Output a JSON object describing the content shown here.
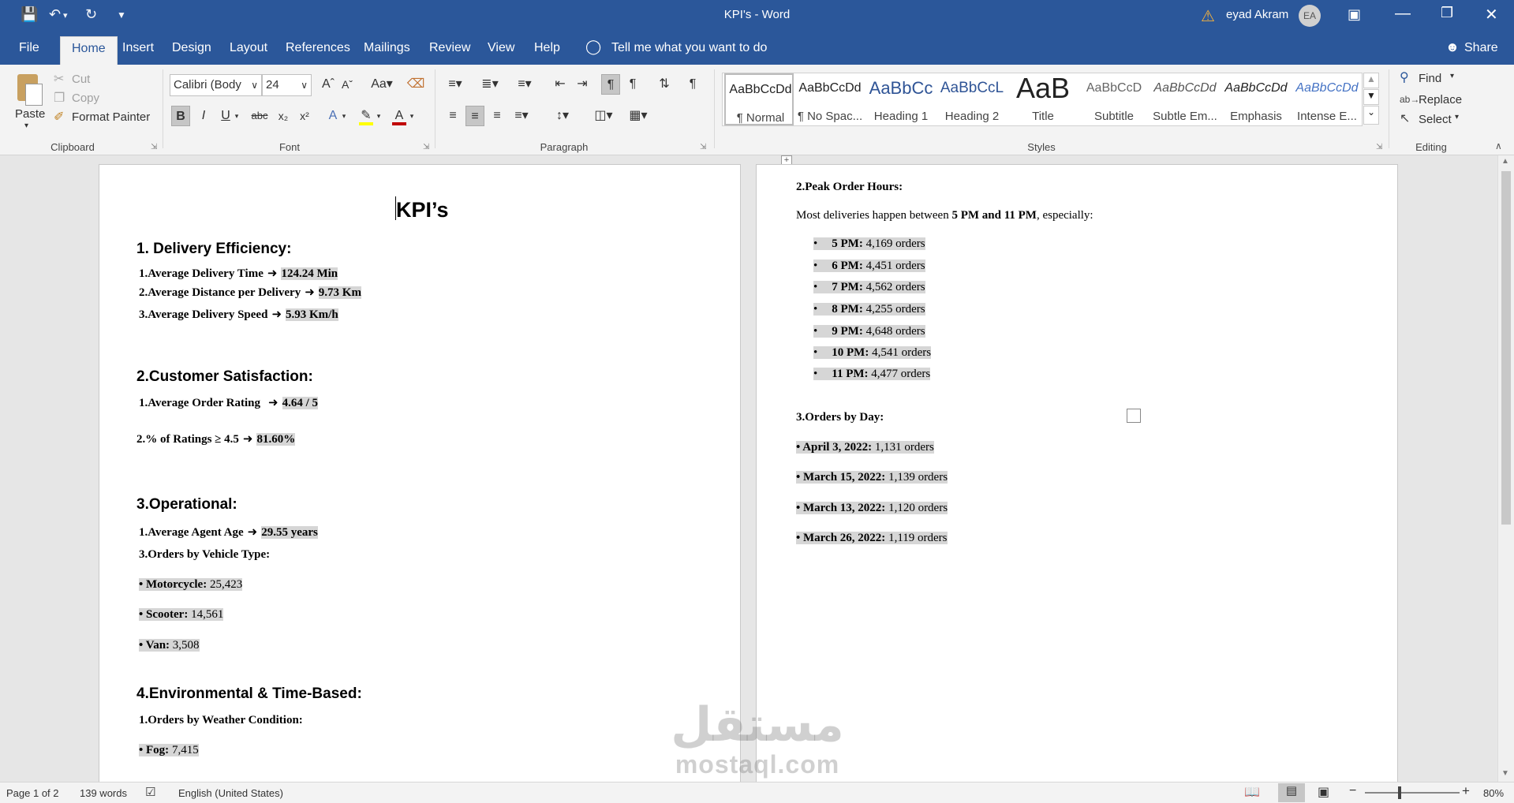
{
  "window": {
    "title": "KPI's  -  Word",
    "user_name": "eyad Akram",
    "user_initials": "EA"
  },
  "menu_tabs": [
    {
      "label": "File"
    },
    {
      "label": "Home"
    },
    {
      "label": "Insert"
    },
    {
      "label": "Design"
    },
    {
      "label": "Layout"
    },
    {
      "label": "References"
    },
    {
      "label": "Mailings"
    },
    {
      "label": "Review"
    },
    {
      "label": "View"
    },
    {
      "label": "Help"
    }
  ],
  "tell_me": "Tell me what you want to do",
  "share_label": "Share",
  "clipboard": {
    "paste": "Paste",
    "cut": "Cut",
    "copy": "Copy",
    "format_painter": "Format Painter",
    "label": "Clipboard"
  },
  "font": {
    "name": "Calibri (Body",
    "size": "24",
    "label": "Font",
    "highlight_color": "#ffff00",
    "font_color": "#c00000"
  },
  "paragraph": {
    "label": "Paragraph"
  },
  "styles": {
    "label": "Styles",
    "items": [
      {
        "preview": "AaBbCcDd",
        "name": "¶ Normal"
      },
      {
        "preview": "AaBbCcDd",
        "name": "¶ No Spac..."
      },
      {
        "preview": "AaBbCc",
        "name": "Heading 1"
      },
      {
        "preview": "AaBbCcL",
        "name": "Heading 2"
      },
      {
        "preview": "AaB",
        "name": "Title"
      },
      {
        "preview": "AaBbCcD",
        "name": "Subtitle"
      },
      {
        "preview": "AaBbCcDd",
        "name": "Subtle Em..."
      },
      {
        "preview": "AaBbCcDd",
        "name": "Emphasis"
      },
      {
        "preview": "AaBbCcDd",
        "name": "Intense E..."
      }
    ]
  },
  "editing": {
    "find": "Find",
    "replace": "Replace",
    "select": "Select",
    "label": "Editing"
  },
  "document": {
    "page1": {
      "title": "KPI’s",
      "s1_heading": "1. Delivery Efficiency:",
      "s1": [
        {
          "num": "1.",
          "label": "Average Delivery Time",
          "value": "124.24 Min"
        },
        {
          "num": "2.",
          "label": "Average Distance per Delivery",
          "value": "9.73 Km"
        },
        {
          "num": "3.",
          "label": "Average Delivery Speed",
          "value": "5.93 Km/h"
        }
      ],
      "s2_heading": "2.Customer Satisfaction:",
      "s2": [
        {
          "num": "1.",
          "label": "Average Order Rating",
          "value": "4.64 / 5"
        },
        {
          "num": "2.",
          "label": "% of Ratings ≥ 4.5",
          "value": "81.60%"
        }
      ],
      "s3_heading": "3.Operational:",
      "s3_age": {
        "num": "1.",
        "label": "Average Agent Age",
        "value": "29.55 years"
      },
      "s3_vehicle_heading": "3.Orders by Vehicle Type:",
      "vehicles": [
        {
          "name": "Motorcycle:",
          "value": "25,423"
        },
        {
          "name": "Scooter:",
          "value": "14,561"
        },
        {
          "name": "Van:",
          "value": "3,508"
        }
      ],
      "s4_heading": "4.Environmental & Time-Based:",
      "s4_weather_heading": "1.Orders by Weather Condition:",
      "weather": [
        {
          "name": "Fog:",
          "value": "7,415"
        }
      ]
    },
    "page2": {
      "peak_heading": "2.Peak Order Hours:",
      "peak_intro_1": "Most deliveries happen between ",
      "peak_intro_bold": "5 PM and 11 PM",
      "peak_intro_2": ", especially:",
      "hours": [
        {
          "hour": "5 PM:",
          "orders": "4,169 orders"
        },
        {
          "hour": "6 PM:",
          "orders": "4,451 orders"
        },
        {
          "hour": "7 PM:",
          "orders": "4,562 orders"
        },
        {
          "hour": "8 PM:",
          "orders": "4,255 orders"
        },
        {
          "hour": "9 PM:",
          "orders": "4,648 orders"
        },
        {
          "hour": "10 PM:",
          "orders": "4,541 orders"
        },
        {
          "hour": "11 PM:",
          "orders": "4,477 orders"
        }
      ],
      "days_heading": "3.Orders by Day:",
      "days": [
        {
          "date": "April 3, 2022:",
          "orders": "1,131 orders"
        },
        {
          "date": "March 15, 2022:",
          "orders": "1,139 orders"
        },
        {
          "date": "March 13, 2022:",
          "orders": "1,120 orders"
        },
        {
          "date": "March 26, 2022:",
          "orders": "1,119 orders"
        }
      ]
    }
  },
  "status": {
    "page": "Page 1 of 2",
    "words": "139 words",
    "language": "English (United States)",
    "zoom": "80%"
  },
  "watermark": {
    "arabic": "مستقل",
    "latin": "mostaql.com"
  }
}
